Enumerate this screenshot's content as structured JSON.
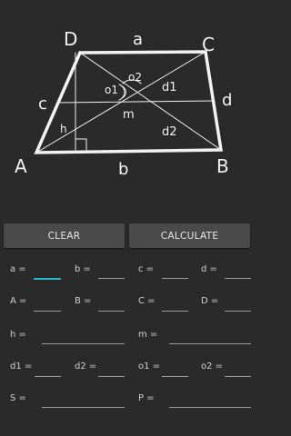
{
  "diagram": {
    "vertices": {
      "A": "A",
      "B": "B",
      "C": "C",
      "D": "D"
    },
    "sides": {
      "a": "a",
      "b": "b",
      "c": "c",
      "d": "d"
    },
    "inner": {
      "h": "h",
      "m": "m",
      "d1": "d1",
      "d2": "d2",
      "o1": "o1",
      "o2": "o2"
    }
  },
  "buttons": {
    "clear": "CLEAR",
    "calculate": "CALCULATE"
  },
  "fields": {
    "a": "a =",
    "b": "b =",
    "c": "c =",
    "d": "d =",
    "A": "A =",
    "B": "B =",
    "C": "C =",
    "D": "D =",
    "h": "h =",
    "m": "m =",
    "d1": "d1 =",
    "d2": "d2 =",
    "o1": "o1 =",
    "o2": "o2 =",
    "S": "S =",
    "P": "P ="
  },
  "colors": {
    "background": "#2a2a2a",
    "button": "#4a4a4a",
    "accent": "#27b9c9"
  }
}
